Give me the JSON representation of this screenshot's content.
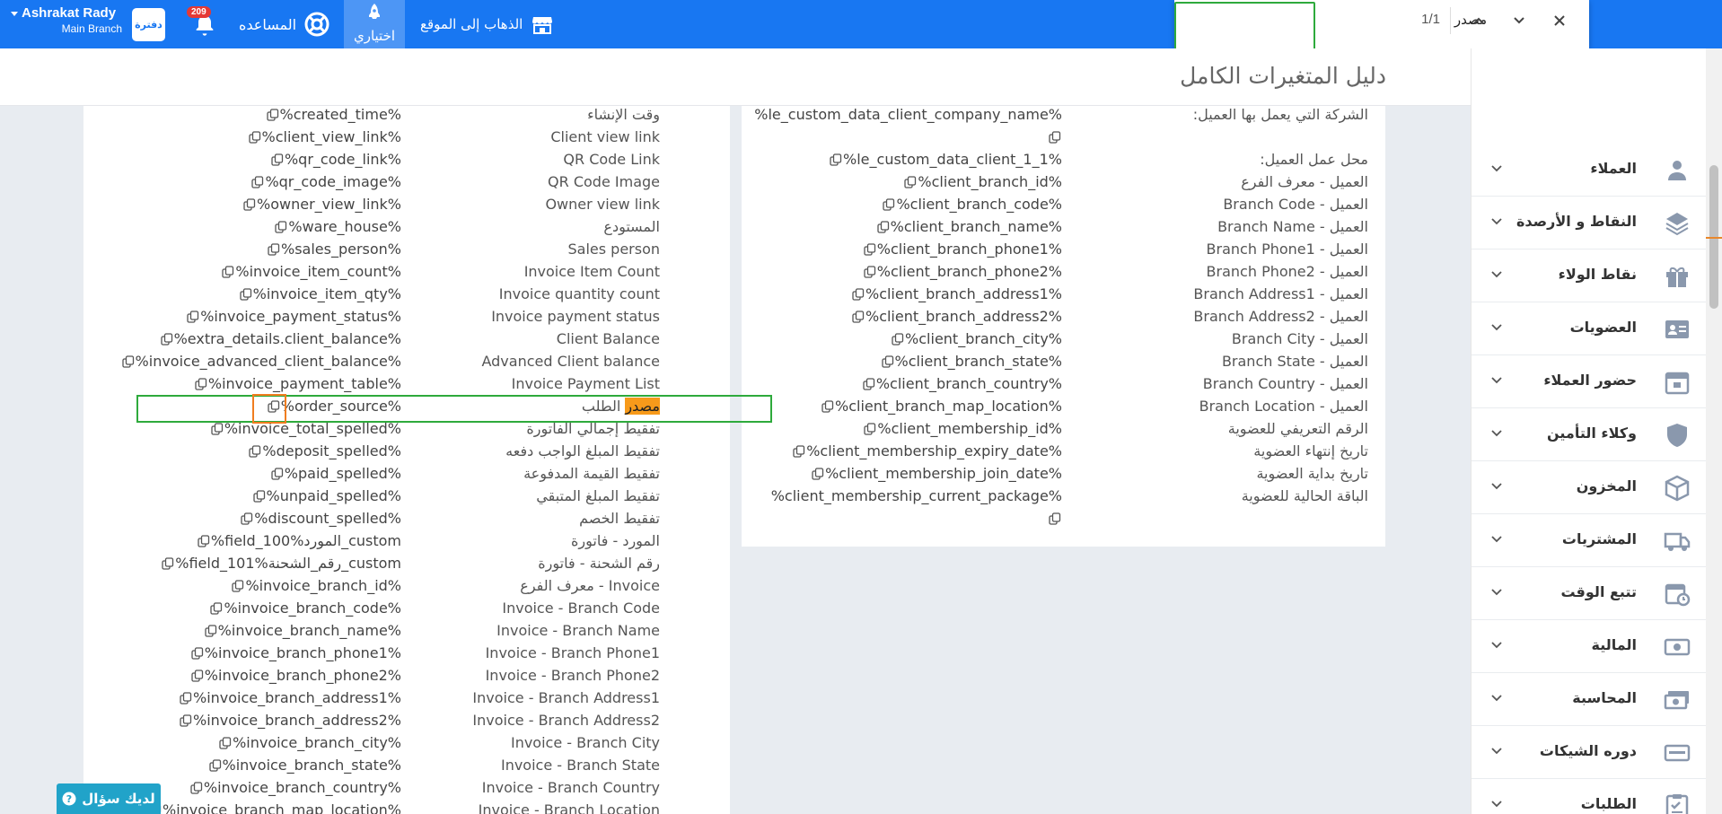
{
  "topbar": {
    "user_name": "Ashrakat Rady",
    "branch": "Main Branch",
    "logo_text": "دفترة",
    "notifications_count": "209",
    "help_label": "المساعده",
    "mine_label": "اختياري",
    "goto_site_label": "الذهاب إلى الموقع"
  },
  "find": {
    "query": "مصدر",
    "count": "1/1"
  },
  "page": {
    "title": "دليل المتغيرات الكامل"
  },
  "left_rows": [
    {
      "label": "وقت الإنشاء",
      "var": "%created_time%"
    },
    {
      "label": "Client view link",
      "var": "%client_view_link%"
    },
    {
      "label": "QR Code Link",
      "var": "%qr_code_link%"
    },
    {
      "label": "QR Code Image",
      "var": "%qr_code_image%"
    },
    {
      "label": "Owner view link",
      "var": "%owner_view_link%"
    },
    {
      "label": "المستودع",
      "var": "%ware_house%"
    },
    {
      "label": "Sales person",
      "var": "%sales_person%"
    },
    {
      "label": "Invoice Item Count",
      "var": "%invoice_item_count%"
    },
    {
      "label": "Invoice quantity count",
      "var": "%invoice_item_qty%"
    },
    {
      "label": "Invoice payment status",
      "var": "%invoice_payment_status%"
    },
    {
      "label": "Client Balance",
      "var": "%extra_details.client_balance%"
    },
    {
      "label": "Advanced Client balance",
      "var": "%invoice_advanced_client_balance%"
    },
    {
      "label": "Invoice Payment List",
      "var": "%invoice_payment_table%"
    },
    {
      "label": "مصدر الطلب",
      "var": "%order_source%"
    },
    {
      "label": "تفقيط إجمالي الفاتورة",
      "var": "%invoice_total_spelled%"
    },
    {
      "label": "تفقيط المبلغ الواجب دفعه",
      "var": "%deposit_spelled%"
    },
    {
      "label": "تفقيط القيمة المدفوعة",
      "var": "%paid_spelled%"
    },
    {
      "label": "تفقيط المبلغ المتبقي",
      "var": "%unpaid_spelled%"
    },
    {
      "label": "تفقيط الخصم",
      "var": "%discount_spelled%"
    },
    {
      "label": "المورد - فاتورة",
      "var": "%field_100%المورد_custom"
    },
    {
      "label": "رقم الشحنة - فاتورة",
      "var": "%field_101%رقم_الشحنة_custom"
    },
    {
      "label": "Invoice - معرف الفرع",
      "var": "%invoice_branch_id%"
    },
    {
      "label": "Invoice - Branch Code",
      "var": "%invoice_branch_code%"
    },
    {
      "label": "Invoice - Branch Name",
      "var": "%invoice_branch_name%"
    },
    {
      "label": "Invoice - Branch Phone1",
      "var": "%invoice_branch_phone1%"
    },
    {
      "label": "Invoice - Branch Phone2",
      "var": "%invoice_branch_phone2%"
    },
    {
      "label": "Invoice - Branch Address1",
      "var": "%invoice_branch_address1%"
    },
    {
      "label": "Invoice - Branch Address2",
      "var": "%invoice_branch_address2%"
    },
    {
      "label": "Invoice - Branch City",
      "var": "%invoice_branch_city%"
    },
    {
      "label": "Invoice - Branch State",
      "var": "%invoice_branch_state%"
    },
    {
      "label": "Invoice - Branch Country",
      "var": "%invoice_branch_country%"
    },
    {
      "label": "Invoice - Branch Location",
      "var": "%invoice_branch_map_location%"
    }
  ],
  "right_rows": [
    {
      "label": "الشركة التي يعمل بها العميل:",
      "var": "%le_custom_data_client_company_name%"
    },
    {
      "label": "",
      "var": ""
    },
    {
      "label": "محل عمل العميل:",
      "var": "%le_custom_data_client_1_1%"
    },
    {
      "label": "العميل - معرف الفرع",
      "var": "%client_branch_id%"
    },
    {
      "label": "العميل - Branch Code",
      "var": "%client_branch_code%"
    },
    {
      "label": "العميل - Branch Name",
      "var": "%client_branch_name%"
    },
    {
      "label": "العميل - Branch Phone1",
      "var": "%client_branch_phone1%"
    },
    {
      "label": "العميل - Branch Phone2",
      "var": "%client_branch_phone2%"
    },
    {
      "label": "العميل - Branch Address1",
      "var": "%client_branch_address1%"
    },
    {
      "label": "العميل - Branch Address2",
      "var": "%client_branch_address2%"
    },
    {
      "label": "العميل - Branch City",
      "var": "%client_branch_city%"
    },
    {
      "label": "العميل - Branch State",
      "var": "%client_branch_state%"
    },
    {
      "label": "العميل - Branch Country",
      "var": "%client_branch_country%"
    },
    {
      "label": "العميل - Branch Location",
      "var": "%client_branch_map_location%"
    },
    {
      "label": "الرقم التعريفي للعضوية",
      "var": "%client_membership_id%"
    },
    {
      "label": "تاريخ إنتهاء العضوية",
      "var": "%client_membership_expiry_date%"
    },
    {
      "label": "تاريخ بداية العضوية",
      "var": "%client_membership_join_date%"
    },
    {
      "label": "الباقة الحالية للعضوية",
      "var": "%client_membership_current_package%"
    }
  ],
  "sidebar": {
    "items": [
      {
        "label": "العملاء",
        "icon": "users-icon"
      },
      {
        "label": "النقاط و الأرصدة",
        "icon": "layers-icon"
      },
      {
        "label": "نقاط الولاء",
        "icon": "gift-icon"
      },
      {
        "label": "العضويات",
        "icon": "id-card-icon"
      },
      {
        "label": "حضور العملاء",
        "icon": "calendar-icon"
      },
      {
        "label": "وكلاء التأمين",
        "icon": "shield-icon"
      },
      {
        "label": "المخزون",
        "icon": "box-icon"
      },
      {
        "label": "المشتريات",
        "icon": "truck-icon"
      },
      {
        "label": "تتبع الوقت",
        "icon": "clock-calendar-icon"
      },
      {
        "label": "المالية",
        "icon": "money-icon"
      },
      {
        "label": "المحاسبة",
        "icon": "cash-icon"
      },
      {
        "label": "دوره الشيكات",
        "icon": "cheque-icon"
      },
      {
        "label": "الطلبات",
        "icon": "clipboard-icon"
      }
    ]
  },
  "ask_button": "لديك سؤال",
  "colors": {
    "topbar": "#1877f2",
    "highlight": "#f79a1a",
    "find_box_border": "#2eaa3c",
    "copy_box_border": "#f07d20"
  }
}
